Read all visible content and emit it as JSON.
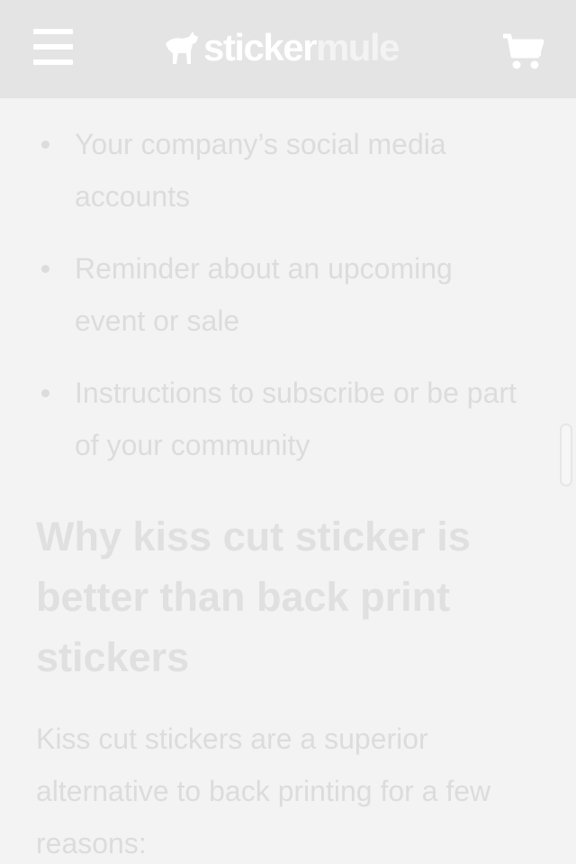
{
  "header": {
    "logo_text_primary": "sticker",
    "logo_text_secondary": "mule",
    "menu_icon": "hamburger-menu-icon",
    "logo_icon": "mule-icon",
    "cart_icon": "shopping-cart-icon",
    "colors": {
      "header_bg": "#e4e4e4",
      "icon": "#ffffff"
    }
  },
  "content": {
    "bullets": [
      {
        "text": "Your company’s social media accounts"
      },
      {
        "text": "Reminder about an upcoming event or sale"
      },
      {
        "text": "Instructions to subscribe or be part of your community"
      }
    ],
    "heading": "Why kiss cut sticker is better than back print stickers",
    "paragraph": "Kiss cut stickers are a superior alternative to back printing for a few reasons:"
  }
}
